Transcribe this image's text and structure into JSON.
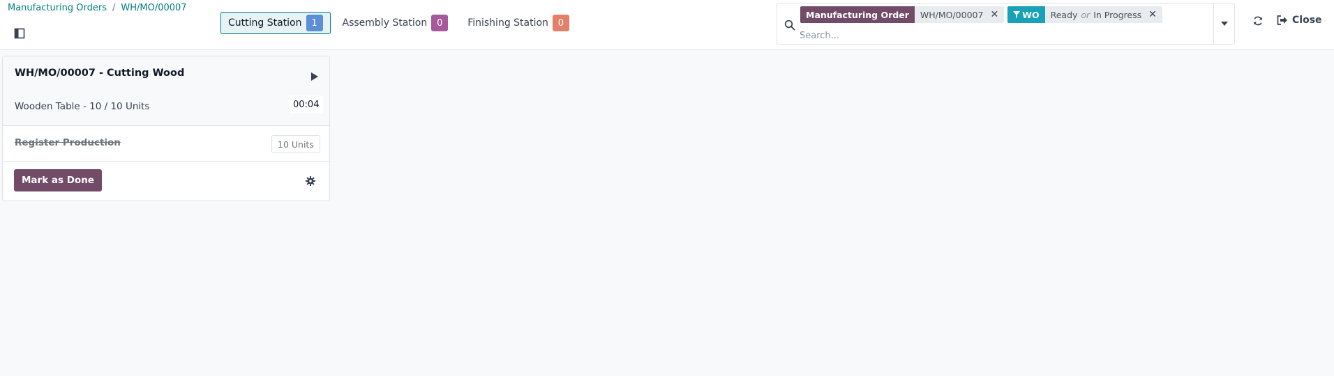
{
  "breadcrumb": {
    "parent": "Manufacturing Orders",
    "separator": "/",
    "current": "WH/MO/00007"
  },
  "stations": [
    {
      "label": "Cutting Station",
      "count": "1",
      "color": "#5b8fd8",
      "active": true
    },
    {
      "label": "Assembly Station",
      "count": "0",
      "color": "#a75a9b",
      "active": false
    },
    {
      "label": "Finishing Station",
      "count": "0",
      "color": "#e2806a",
      "active": false
    }
  ],
  "search": {
    "facets": [
      {
        "label": "Manufacturing Order",
        "values": [
          "WH/MO/00007"
        ],
        "icon": null
      },
      {
        "label": "WO",
        "values": [
          "Ready",
          "In Progress"
        ],
        "joiner": "or",
        "icon": "filter-icon"
      }
    ],
    "placeholder": "Search..."
  },
  "controls": {
    "refresh_icon": "refresh-icon",
    "close_label": "Close"
  },
  "card": {
    "title": "WH/MO/00007 - Cutting Wood",
    "subtitle": "Wooden Table - 10 / 10 Units",
    "timer": "00:04",
    "step": {
      "label": "Register Production",
      "quantity": "10 Units",
      "done": true
    },
    "action_label": "Mark as Done"
  },
  "colors": {
    "brand": "#714b67",
    "accent": "#017e84",
    "teal": "#17a2b8"
  }
}
